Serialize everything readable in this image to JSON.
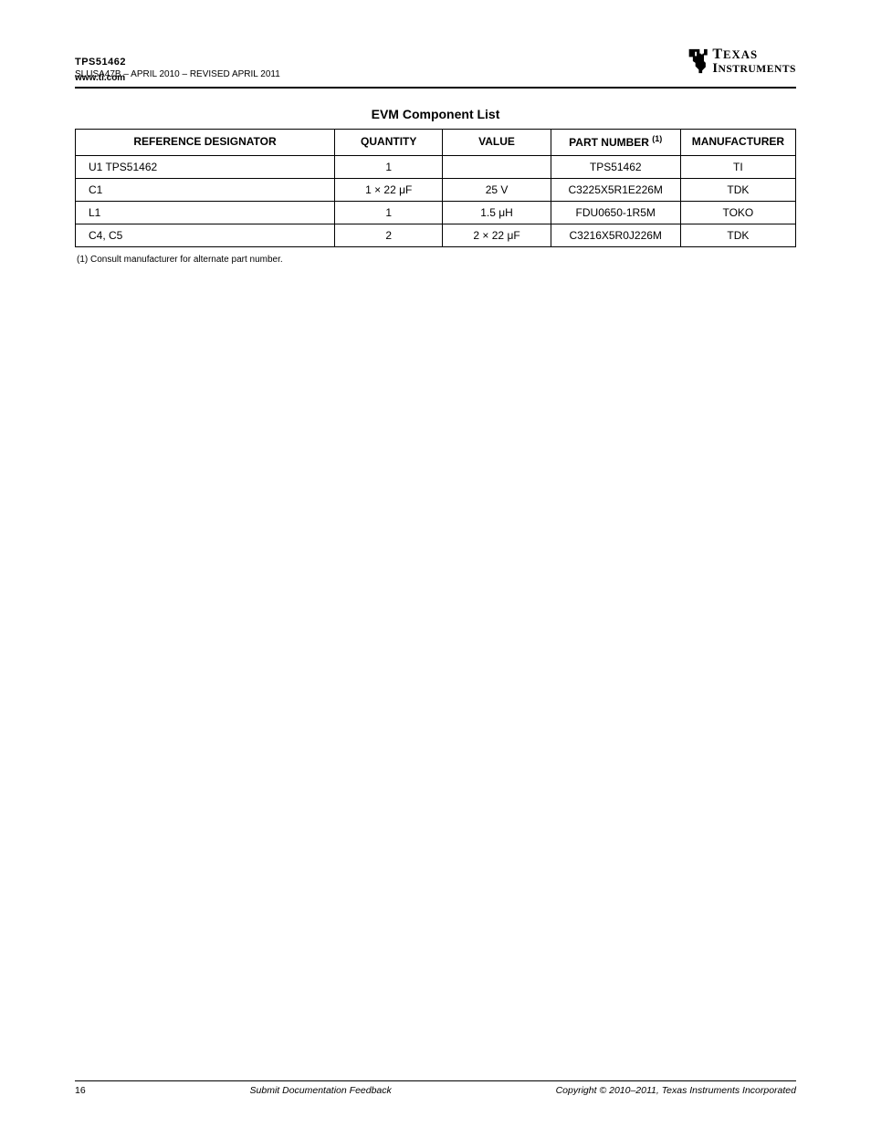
{
  "header": {
    "part_line": "TPS51462",
    "doc_id_html": "SLUSA47B – APRIL 2010 – REVISED APRIL 2011",
    "url": "www.ti.com",
    "logo_w1_html": "T<span class='sc'>EXAS</span>",
    "logo_w2_html": "I<span class='sc'>NSTRUMENTS</span>"
  },
  "table_title": "EVM Component List",
  "columns": {
    "c0": "REFERENCE DESIGNATOR",
    "c1": "QUANTITY",
    "c2": "VALUE",
    "c3_html": "PART NUMBER <span class='sup'>(1)</span>",
    "c4": "MANUFACTURER"
  },
  "rows": [
    {
      "c0": "U1 TPS51462",
      "c1": "1",
      "c2": "",
      "c3": "TPS51462",
      "c4": "TI"
    },
    {
      "c0": "C1",
      "c1": "1 × 22 μF",
      "c2": "25 V",
      "c3": "C3225X5R1E226M",
      "c4": "TDK"
    },
    {
      "c0": "L1",
      "c1": "1",
      "c2": "1.5 μH",
      "c3": "FDU0650-1R5M",
      "c4": "TOKO"
    },
    {
      "c0": "C4, C5",
      "c1": "2",
      "c2": "2 × 22 μF",
      "c3": "C3216X5R0J226M",
      "c4": "TDK"
    }
  ],
  "footnote": "(1) Consult manufacturer for alternate part number.",
  "footer": {
    "page": "16",
    "submit": "Submit Documentation Feedback",
    "copyright_html": "Copyright © 2010–2011, Texas Instruments Incorporated"
  }
}
